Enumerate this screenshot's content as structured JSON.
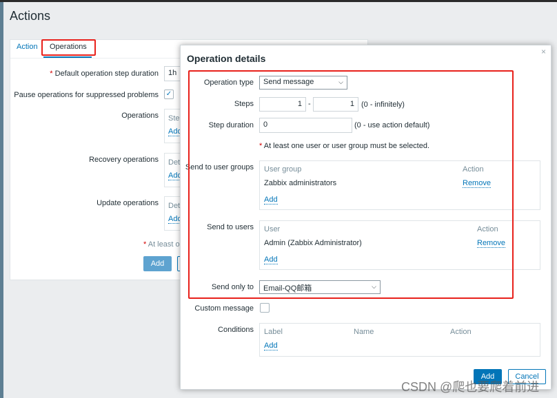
{
  "page": {
    "title": "Actions"
  },
  "tabs": [
    {
      "label": "Action"
    },
    {
      "label": "Operations"
    }
  ],
  "form": {
    "default_step_required": "*",
    "default_step_label": "Default operation step duration",
    "default_step_value": "1h",
    "pause_label": "Pause operations for suppressed problems",
    "pause_checked": true,
    "operations_label": "Operations",
    "operations_partial": "Ste",
    "recovery_label": "Recovery operations",
    "recovery_partial": "Det",
    "update_label": "Update operations",
    "update_partial": "Det",
    "add_partial": "Add",
    "at_least_required": "*",
    "at_least_partial": "At least o",
    "add_button": "Add"
  },
  "modal": {
    "title": "Operation details",
    "close_icon": "close-icon",
    "operation_type_label": "Operation type",
    "operation_type_value": "Send message",
    "steps_label": "Steps",
    "steps_from": "1",
    "steps_sep": "-",
    "steps_to": "1",
    "steps_hint": "(0 - infinitely)",
    "step_duration_label": "Step duration",
    "step_duration_value": "0",
    "step_duration_hint": "(0 - use action default)",
    "warning_star": "*",
    "warning": "At least one user or user group must be selected.",
    "user_groups_label": "Send to user groups",
    "user_groups": {
      "col_group": "User group",
      "col_action": "Action",
      "rows": [
        {
          "name": "Zabbix administrators",
          "action": "Remove"
        }
      ],
      "add": "Add"
    },
    "users_label": "Send to users",
    "users": {
      "col_user": "User",
      "col_action": "Action",
      "rows": [
        {
          "name": "Admin (Zabbix Administrator)",
          "action": "Remove"
        }
      ],
      "add": "Add"
    },
    "send_only_label": "Send only to",
    "send_only_value": "Email-QQ邮箱",
    "custom_message_label": "Custom message",
    "custom_message_checked": false,
    "conditions_label": "Conditions",
    "conditions": {
      "col_label": "Label",
      "col_name": "Name",
      "col_action": "Action",
      "add": "Add"
    },
    "add_button": "Add",
    "cancel_button": "Cancel"
  },
  "watermark": "CSDN @爬也要爬着前进",
  "colors": {
    "accent": "#0275b8",
    "highlight": "#e8201a"
  }
}
